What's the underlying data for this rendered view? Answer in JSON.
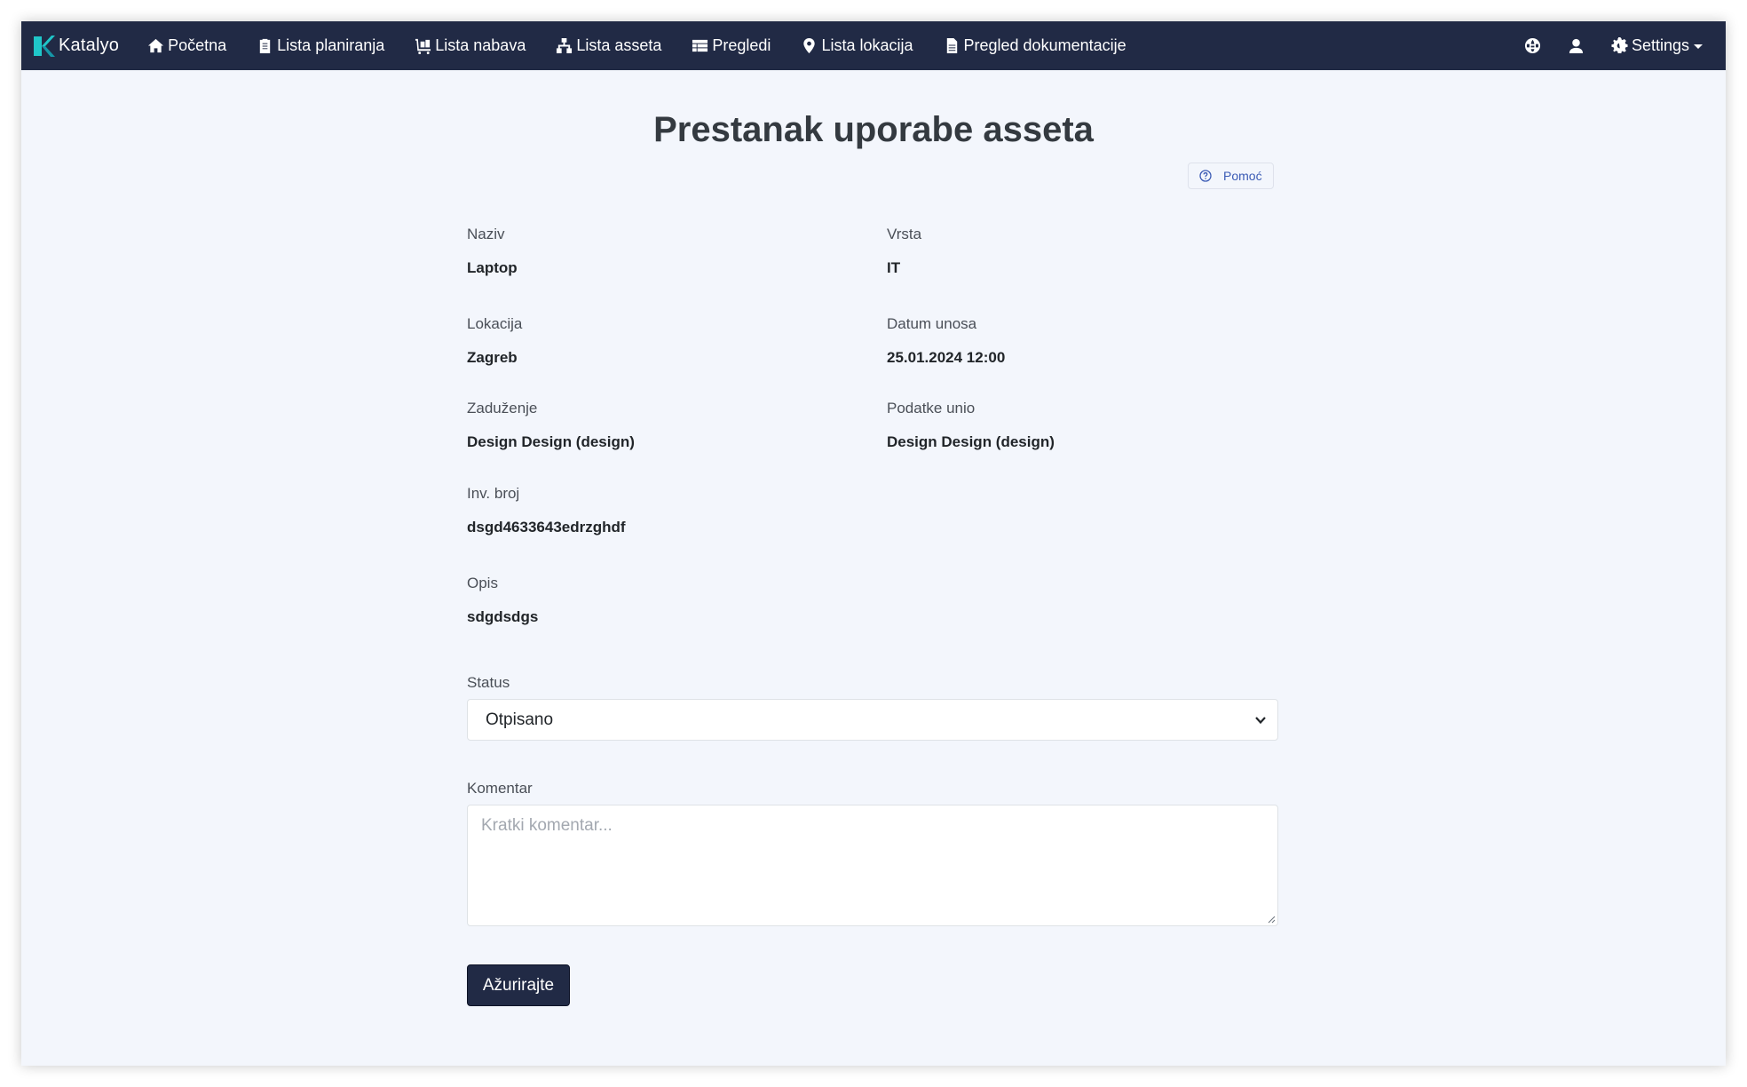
{
  "app": {
    "brand": "Katalyo",
    "brand_color": "#1fc6c9"
  },
  "navbar": {
    "background": "#212a45",
    "items": [
      {
        "label": "Početna",
        "icon": "home-icon"
      },
      {
        "label": "Lista planiranja",
        "icon": "clipboard-icon"
      },
      {
        "label": "Lista nabava",
        "icon": "dolly-icon"
      },
      {
        "label": "Lista asseta",
        "icon": "sitemap-icon"
      },
      {
        "label": "Pregledi",
        "icon": "table-icon"
      },
      {
        "label": "Lista lokacija",
        "icon": "map-marker-icon"
      },
      {
        "label": "Pregled dokumentacije",
        "icon": "file-icon"
      }
    ],
    "right": {
      "language_icon": "globe-icon",
      "user_icon": "user-icon",
      "settings_label": "Settings",
      "settings_icon": "gear-icon"
    }
  },
  "page": {
    "title": "Prestanak uporabe asseta",
    "help_label": "Pomoć"
  },
  "details": {
    "naziv": {
      "label": "Naziv",
      "value": "Laptop"
    },
    "vrsta": {
      "label": "Vrsta",
      "value": "IT"
    },
    "lokacija": {
      "label": "Lokacija",
      "value": "Zagreb"
    },
    "datum_unosa": {
      "label": "Datum unosa",
      "value": "25.01.2024 12:00"
    },
    "zaduzenje": {
      "label": "Zaduženje",
      "value": "Design Design (design)"
    },
    "podatke_unio": {
      "label": "Podatke unio",
      "value": "Design Design (design)"
    },
    "inv_broj": {
      "label": "Inv. broj",
      "value": "dsgd4633643edrzghdf"
    },
    "opis": {
      "label": "Opis",
      "value": "sdgdsdgs"
    }
  },
  "form": {
    "status_label": "Status",
    "status_value": "Otpisano",
    "comment_label": "Komentar",
    "comment_value": "",
    "comment_placeholder": "Kratki komentar...",
    "submit_label": "Ažurirajte"
  }
}
